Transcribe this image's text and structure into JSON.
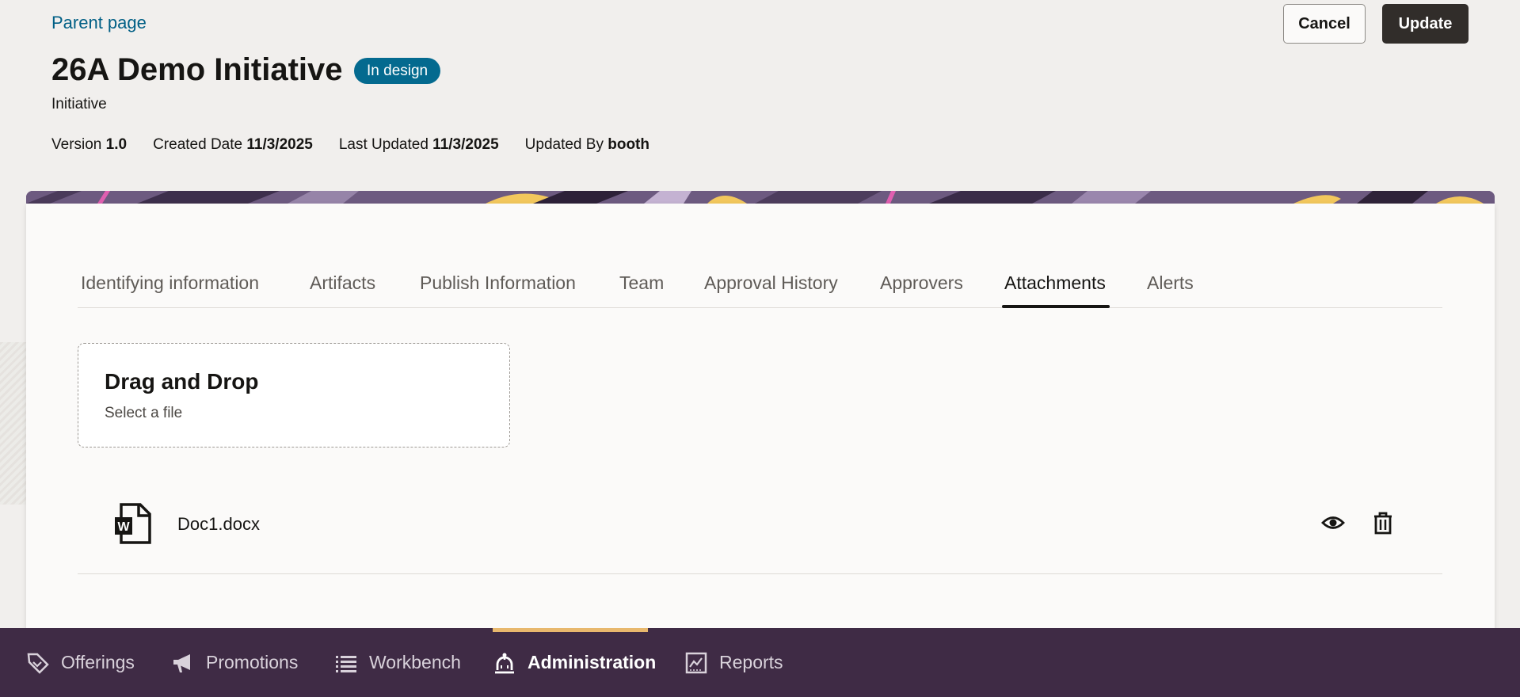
{
  "header": {
    "parent_link": "Parent page",
    "cancel_label": "Cancel",
    "update_label": "Update",
    "title": "26A Demo Initiative",
    "status_badge": "In design",
    "subtitle": "Initiative",
    "meta": {
      "version_label": "Version",
      "version_value": "1.0",
      "created_label": "Created Date",
      "created_value": "11/3/2025",
      "updated_label": "Last Updated",
      "updated_value": "11/3/2025",
      "updated_by_label": "Updated By",
      "updated_by_value": "booth"
    }
  },
  "tabs": [
    {
      "label": "Identifying information"
    },
    {
      "label": "Artifacts"
    },
    {
      "label": "Publish Information"
    },
    {
      "label": "Team"
    },
    {
      "label": "Approval History"
    },
    {
      "label": "Approvers"
    },
    {
      "label": "Attachments",
      "active": true
    },
    {
      "label": "Alerts"
    }
  ],
  "dropzone": {
    "title": "Drag and Drop",
    "subtitle": "Select a file"
  },
  "attachments": [
    {
      "name": "Doc1.docx",
      "icon": "word-document-icon"
    }
  ],
  "bottom_nav": [
    {
      "label": "Offerings",
      "icon": "tag-icon"
    },
    {
      "label": "Promotions",
      "icon": "megaphone-icon"
    },
    {
      "label": "Workbench",
      "icon": "list-icon"
    },
    {
      "label": "Administration",
      "icon": "admin-icon",
      "active": true
    },
    {
      "label": "Reports",
      "icon": "report-icon"
    }
  ],
  "colors": {
    "link": "#005f85",
    "badge": "#046a8f",
    "primary_button": "#312d2a",
    "nav_bg": "#3f2b45",
    "nav_active_accent": "#e8b86d",
    "page_bg": "#f1efed"
  }
}
